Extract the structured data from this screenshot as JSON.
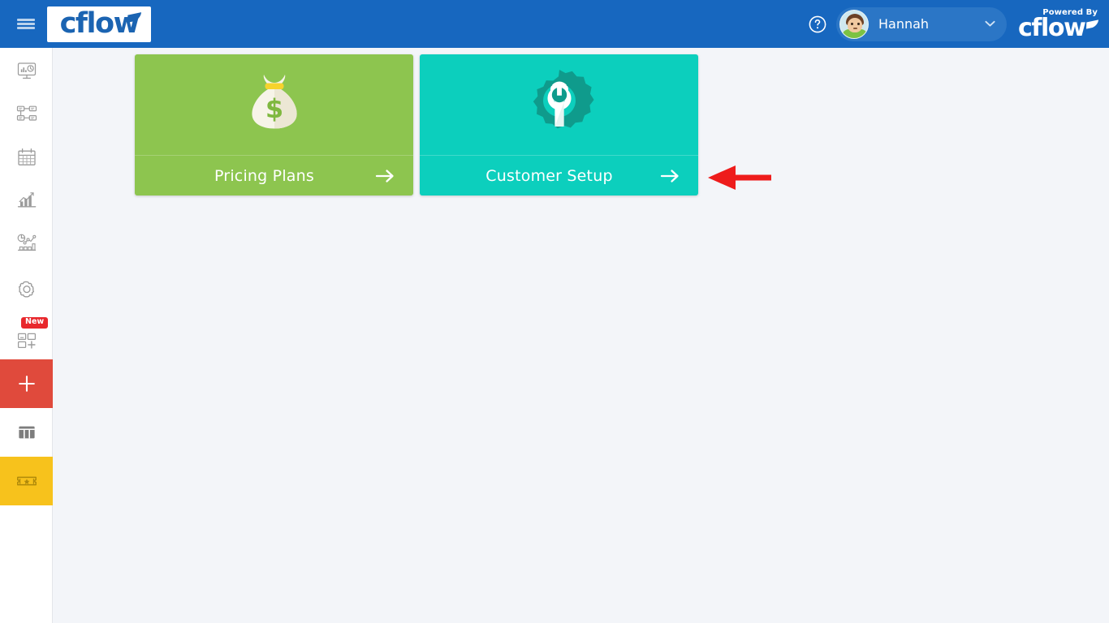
{
  "app": {
    "brand_name": "cflow",
    "powered_by_label": "Powered By",
    "powered_by_brand": "cflow",
    "accent_blue": "#1767bf",
    "background": "#f3f5f9"
  },
  "topbar": {
    "menu_icon": "hamburger-icon",
    "help_icon": "help-circle-icon",
    "user_name": "Hannah",
    "user_caret_icon": "chevron-down-icon",
    "avatar_icon": "user-avatar"
  },
  "sidebar": {
    "items": [
      {
        "name": "dashboard",
        "icon": "monitor-dashboard-icon",
        "badge": "",
        "bg": "#ffffff"
      },
      {
        "name": "workflows",
        "icon": "workflow-diagram-icon",
        "badge": "",
        "bg": "#ffffff"
      },
      {
        "name": "calendar",
        "icon": "calendar-icon",
        "badge": "",
        "bg": "#ffffff"
      },
      {
        "name": "reports",
        "icon": "bar-chart-growth-icon",
        "badge": "",
        "bg": "#ffffff"
      },
      {
        "name": "analytics",
        "icon": "analytics-charts-icon",
        "badge": "",
        "bg": "#ffffff"
      },
      {
        "name": "settings",
        "icon": "gear-icon",
        "badge": "",
        "bg": "#ffffff"
      },
      {
        "name": "apps",
        "icon": "apps-grid-plus-icon",
        "badge": "New",
        "bg": "#ffffff"
      },
      {
        "name": "add-new",
        "icon": "plus-icon",
        "badge": "",
        "bg": "#e04a3c"
      },
      {
        "name": "kanban-board",
        "icon": "kanban-columns-icon",
        "badge": "",
        "bg": "#ffffff"
      },
      {
        "name": "tickets",
        "icon": "ticket-star-icon",
        "badge": "",
        "bg": "#f7c21c"
      }
    ],
    "new_badge_label": "New"
  },
  "main": {
    "tiles": [
      {
        "label": "Pricing Plans",
        "icon": "money-bag-dollar-icon",
        "color": "#8dc54f",
        "arrow_icon": "arrow-right-icon"
      },
      {
        "label": "Customer Setup",
        "icon": "gear-wrench-icon",
        "color": "#0ccfbd",
        "arrow_icon": "arrow-right-icon"
      }
    ],
    "annotation": {
      "name": "red-pointer-arrow",
      "icon": "arrow-left-icon",
      "color": "#ee1c1c"
    }
  }
}
